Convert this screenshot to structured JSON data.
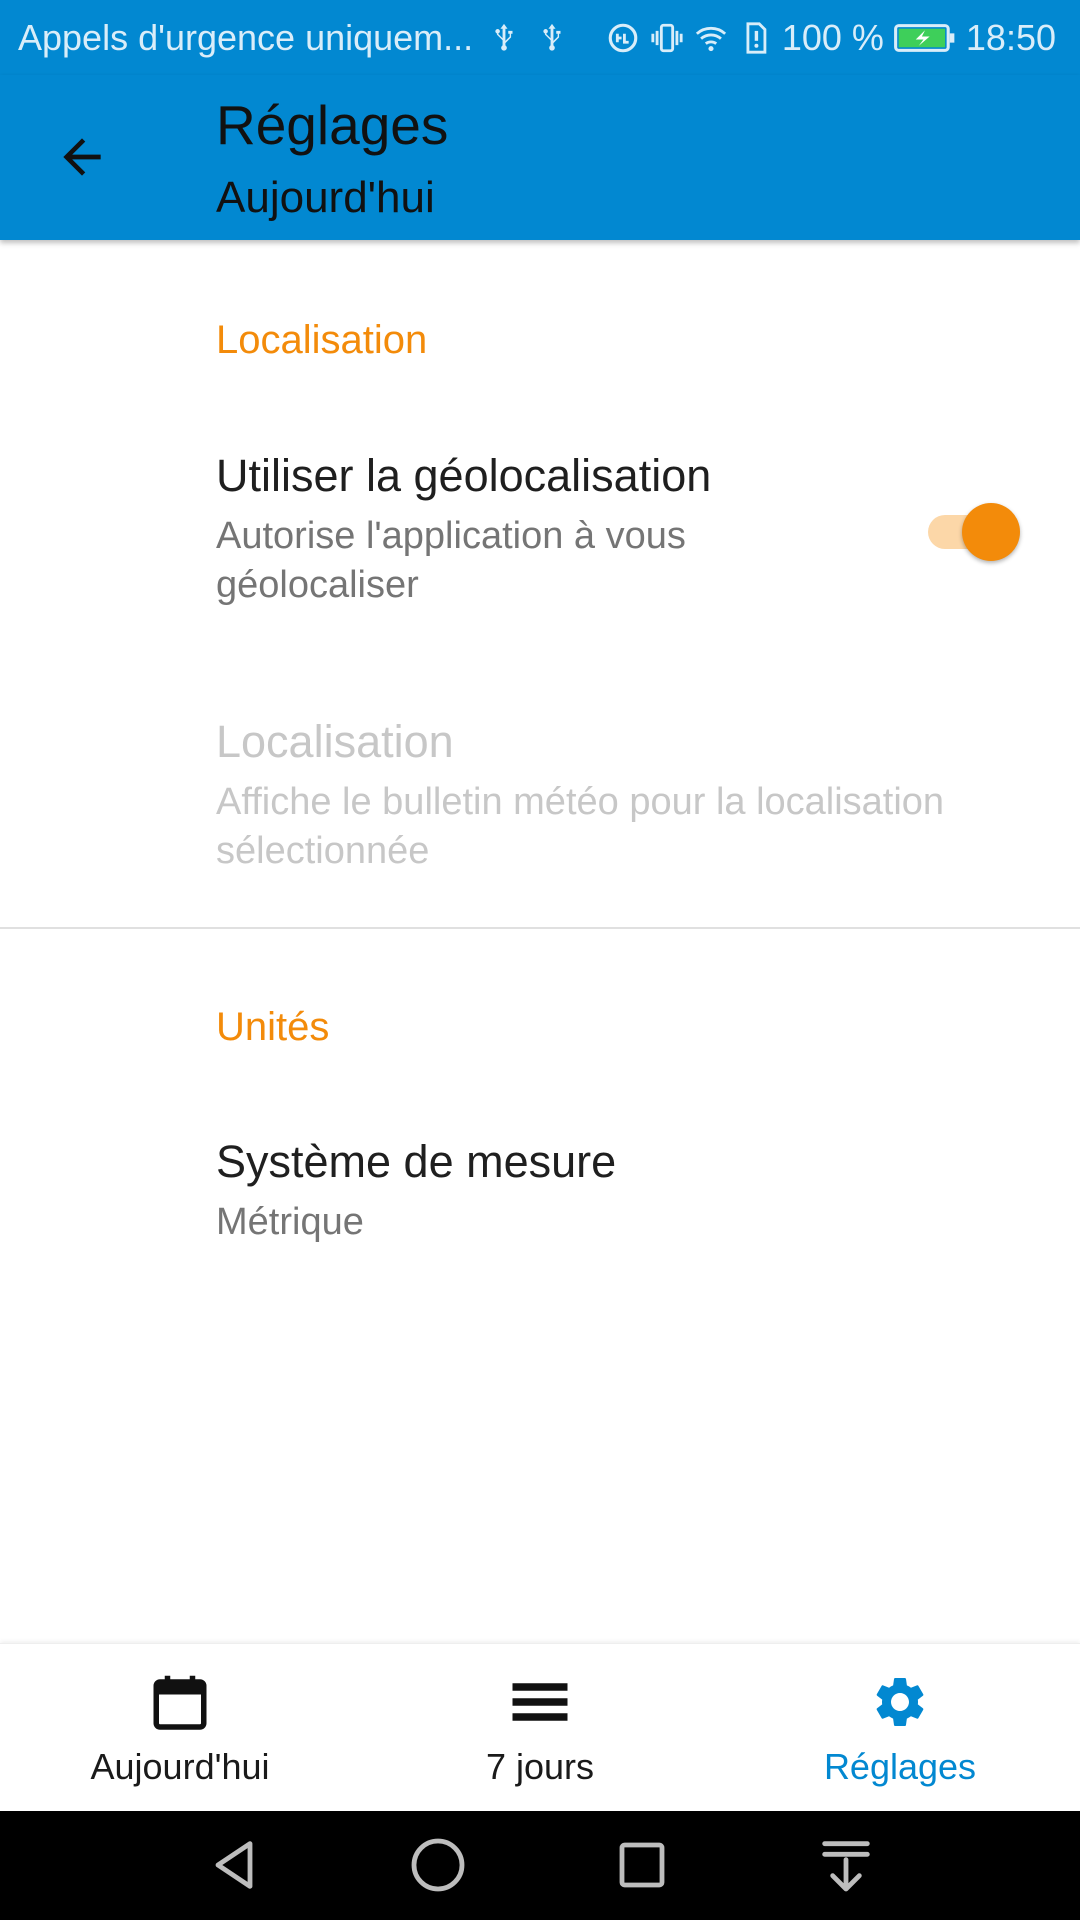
{
  "status_bar": {
    "carrier_text": "Appels d'urgence uniquem...",
    "battery_percent": "100 %",
    "time": "18:50",
    "icons": [
      "usb-icon",
      "usb-icon",
      "data-saver-icon",
      "vibrate-icon",
      "wifi-icon",
      "sim-alert-icon",
      "battery-charging-icon"
    ]
  },
  "app_bar": {
    "title": "Réglages",
    "subtitle": "Aujourd'hui",
    "background_color": "#0288d1"
  },
  "sections": {
    "location": {
      "header": "Localisation",
      "geolocation": {
        "title": "Utiliser la géolocalisation",
        "summary": "Autorise l'application à vous géolocaliser",
        "enabled": true
      },
      "location_pref": {
        "title": "Localisation",
        "summary": "Affiche le bulletin météo pour la localisation sélectionnée",
        "disabled": true
      }
    },
    "units": {
      "header": "Unités",
      "measurement_system": {
        "title": "Système de mesure",
        "value": "Métrique"
      }
    }
  },
  "bottom_nav": {
    "items": [
      {
        "label": "Aujourd'hui",
        "icon": "calendar-icon",
        "active": false
      },
      {
        "label": "7 jours",
        "icon": "list-icon",
        "active": false
      },
      {
        "label": "Réglages",
        "icon": "gear-icon",
        "active": true
      }
    ],
    "active_color": "#0288d1"
  },
  "colors": {
    "accent": "#f38b0a",
    "primary": "#0288d1"
  }
}
